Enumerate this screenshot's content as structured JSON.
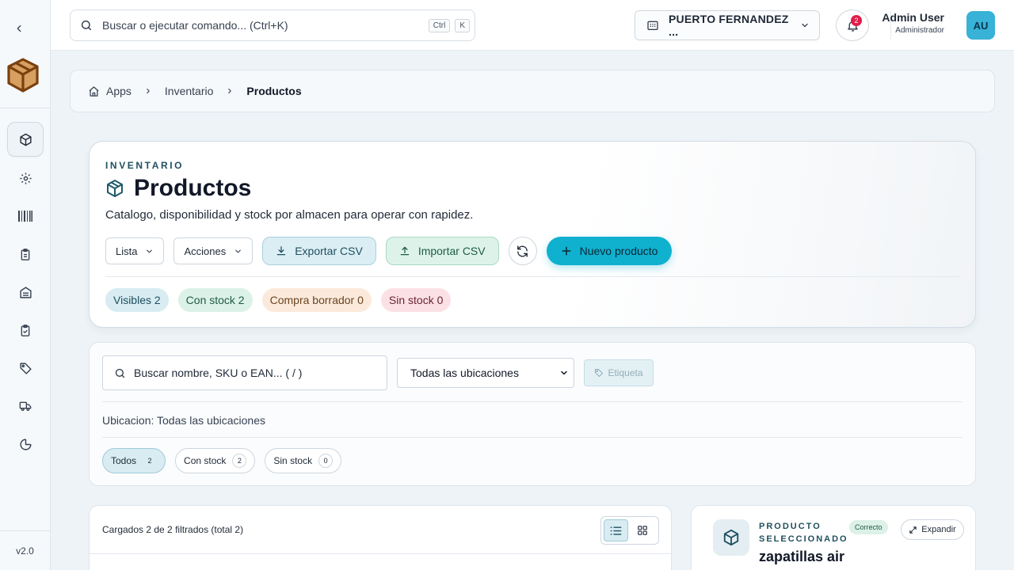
{
  "sidebar": {
    "version": "v2.0",
    "items": [
      {
        "icon": "cube-icon",
        "active": true
      },
      {
        "icon": "gear-icon"
      },
      {
        "icon": "barcode-icon"
      },
      {
        "icon": "clipboard-icon"
      },
      {
        "icon": "warehouse-icon"
      },
      {
        "icon": "clipboard-check-icon"
      },
      {
        "icon": "tag-icon"
      },
      {
        "icon": "truck-icon"
      },
      {
        "icon": "pie-chart-icon"
      }
    ]
  },
  "topbar": {
    "command_placeholder": "Buscar o ejecutar comando... (Ctrl+K)",
    "kbd_ctrl": "Ctrl",
    "kbd_k": "K",
    "store_name": "PUERTO FERNANDEZ ...",
    "notification_count": "2",
    "user_name": "Admin User",
    "user_role": "Administrador",
    "avatar_initials": "AU"
  },
  "breadcrumb": {
    "items": [
      "Apps",
      "Inventario",
      "Productos"
    ]
  },
  "hero": {
    "eyebrow": "INVENTARIO",
    "title": "Productos",
    "subtitle": "Catalogo, disponibilidad y stock por almacen para operar con rapidez.",
    "view_label": "Lista",
    "actions_label": "Acciones",
    "export_label": "Exportar CSV",
    "import_label": "Importar CSV",
    "new_label": "Nuevo producto",
    "chips": [
      "Visibles 2",
      "Con stock 2",
      "Compra borrador 0",
      "Sin stock 0"
    ]
  },
  "filters": {
    "search_placeholder": "Buscar nombre, SKU o EAN... ( / )",
    "location_select": "Todas las ubicaciones",
    "tag_label": "Etiqueta",
    "location_text": "Ubicacion: Todas las ubicaciones",
    "tabs": [
      {
        "label": "Todos",
        "count": "2",
        "active": true
      },
      {
        "label": "Con stock",
        "count": "2"
      },
      {
        "label": "Sin stock",
        "count": "0"
      }
    ]
  },
  "list": {
    "summary": "Cargados 2 de 2 filtrados (total 2)"
  },
  "selected": {
    "label": "PRODUCTO SELECCIONADO",
    "status": "Correcto",
    "expand_label": "Expandir",
    "name": "zapatillas air"
  },
  "colors": {
    "accent": "#10b0cf",
    "brand_logo": "#8a4a12"
  }
}
